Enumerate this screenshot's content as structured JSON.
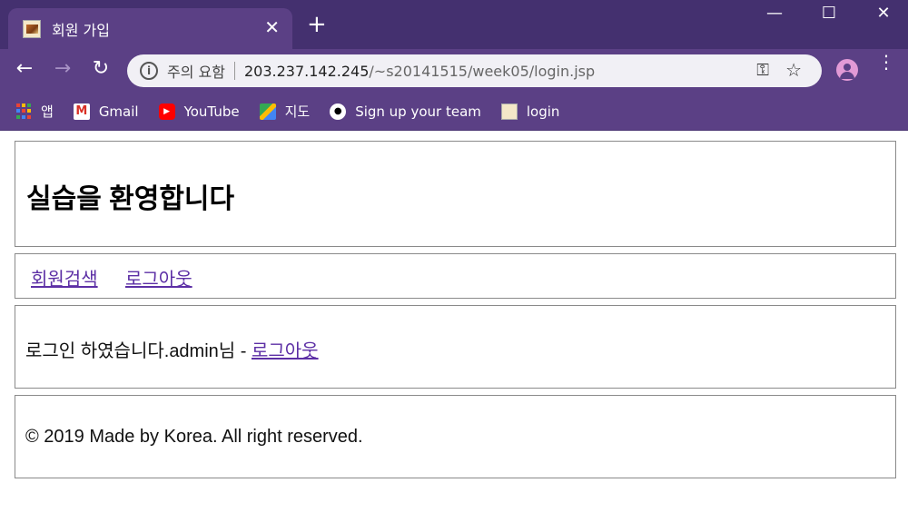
{
  "browser": {
    "tab": {
      "title": "회원 가입",
      "close_glyph": "✕"
    },
    "new_tab_glyph": "+",
    "window_controls": {
      "minimize": "—",
      "maximize": "☐",
      "close": "✕"
    },
    "toolbar": {
      "back_glyph": "←",
      "forward_glyph": "→",
      "reload_glyph": "↻",
      "info_glyph": "i",
      "security_label": "주의 요함",
      "url_host": "203.237.142.245",
      "url_path": "/~s20141515/week05/login.jsp",
      "key_glyph": "⚿",
      "star_glyph": "☆",
      "menu_glyph": "⋮"
    },
    "bookmarks": [
      {
        "label": "앱",
        "icon": "apps-icon"
      },
      {
        "label": "Gmail",
        "icon": "gmail-icon"
      },
      {
        "label": "YouTube",
        "icon": "youtube-icon"
      },
      {
        "label": "지도",
        "icon": "maps-icon"
      },
      {
        "label": "Sign up your team",
        "icon": "github-icon"
      },
      {
        "label": "login",
        "icon": "login-favicon-icon"
      }
    ],
    "colors": {
      "frame": "#44306f",
      "toolbar": "#5b4085",
      "omnibox": "#f1f0f5"
    }
  },
  "page": {
    "heading": "실습을 환영합니다",
    "nav": {
      "search_link": "회원검색",
      "logout_link": "로그아웃"
    },
    "status": {
      "message": "로그인 하였습니다.admin님 - ",
      "logout_link": "로그아웃"
    },
    "footer": {
      "copyright": "© 2019 Made by Korea. All right reserved."
    },
    "link_color": "#5c2fa5"
  }
}
